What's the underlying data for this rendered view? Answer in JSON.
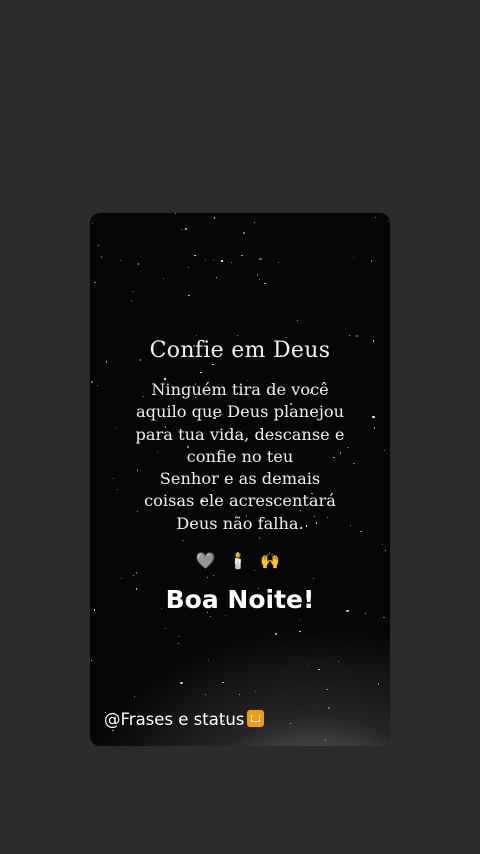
{
  "story": {
    "title": "Confie em Deus",
    "lines": [
      "Ninguém tira de você",
      "aquilo que Deus planejou",
      "para tua vida, descanse e",
      "confie no teu",
      "Senhor e as demais",
      "coisas ele acrescentará",
      "Deus não falha."
    ],
    "emojis": "🩶 🕯️ 🙌",
    "greeting": "Boa Noite!",
    "handle": "@Frases e status",
    "handle_icon": "camera-badge-icon"
  },
  "colors": {
    "background": "#2b2b2b",
    "card": "#060606",
    "text": "#ffffff",
    "badge": "#f39c12"
  }
}
